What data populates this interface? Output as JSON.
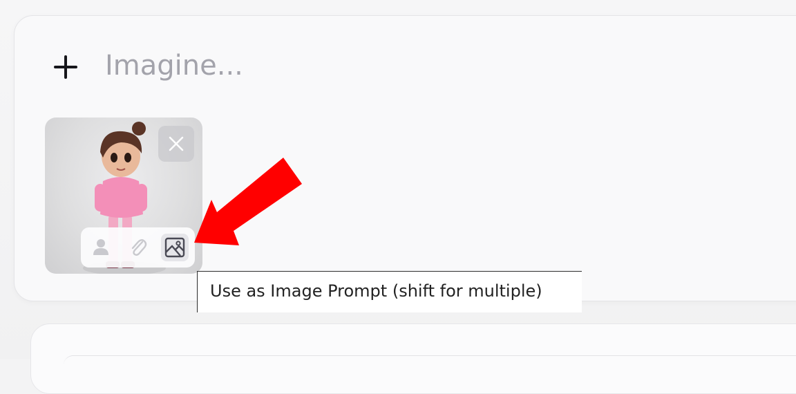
{
  "prompt": {
    "placeholder": "Imagine...",
    "add_button_icon": "plus-icon"
  },
  "image_attachment": {
    "description_icon": "image-thumbnail",
    "remove_icon": "close-icon",
    "toolbar": [
      {
        "icon": "person-icon",
        "active": false
      },
      {
        "icon": "paperclip-icon",
        "active": false
      },
      {
        "icon": "image-prompt-icon",
        "active": true
      }
    ]
  },
  "tooltip": {
    "text": "Use as Image Prompt (shift for multiple)"
  },
  "annotation": {
    "icon": "red-arrow-icon",
    "color": "#ff0000"
  }
}
